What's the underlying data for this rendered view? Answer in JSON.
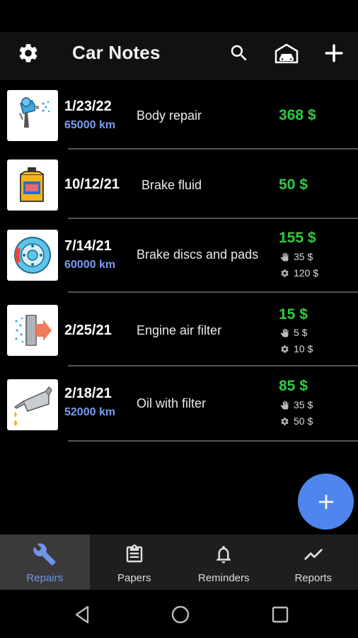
{
  "app": {
    "title": "Car Notes",
    "accent": "#4f86ee",
    "price_color": "#2ecc40",
    "km_color": "#7a9cf0"
  },
  "toolbar": {
    "settings_icon": "gear-icon",
    "search_icon": "search-icon",
    "garage_icon": "garage-icon",
    "add_icon": "plus-icon"
  },
  "repairs": [
    {
      "icon": "spray-gun-icon",
      "date": "1/23/22",
      "km": "65000 km",
      "description": "Body repair",
      "price": "368 $",
      "parts": "",
      "labor": ""
    },
    {
      "icon": "brake-fluid-bottle-icon",
      "date": "10/12/21",
      "km": "",
      "description": "Brake fluid",
      "price": "50 $",
      "parts": "",
      "labor": ""
    },
    {
      "icon": "brake-disc-icon",
      "date": "7/14/21",
      "km": "60000 km",
      "description": "Brake discs and pads",
      "price": "155 $",
      "parts": "35 $",
      "labor": "120 $"
    },
    {
      "icon": "air-filter-icon",
      "date": "2/25/21",
      "km": "",
      "description": "Engine air filter",
      "price": "15 $",
      "parts": "5 $",
      "labor": "10 $"
    },
    {
      "icon": "oil-can-icon",
      "date": "2/18/21",
      "km": "52000 km",
      "description": "Oil with filter",
      "price": "85 $",
      "parts": "35 $",
      "labor": "50 $"
    }
  ],
  "fab": {
    "icon": "plus-icon"
  },
  "bottom_nav": {
    "items": [
      {
        "label": "Repairs",
        "icon": "wrench-icon",
        "active": true
      },
      {
        "label": "Papers",
        "icon": "clipboard-icon",
        "active": false
      },
      {
        "label": "Reminders",
        "icon": "bell-icon",
        "active": false
      },
      {
        "label": "Reports",
        "icon": "chart-line-icon",
        "active": false
      }
    ]
  },
  "system_nav": {
    "back": "back-icon",
    "home": "home-icon",
    "recents": "recents-icon"
  }
}
